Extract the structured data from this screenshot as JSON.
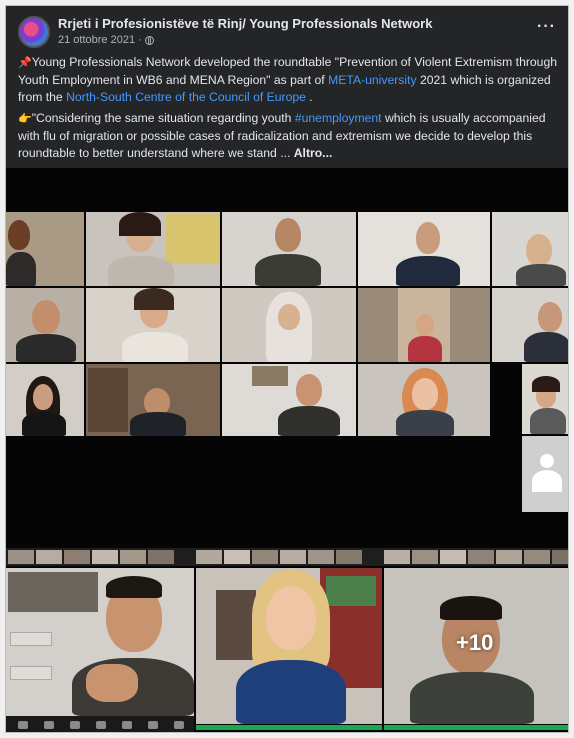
{
  "post": {
    "page_name": "Rrjeti i Profesionistëve të Rinj/ Young Professionals Network",
    "date": "21 ottobre 2021",
    "date_separator": "·",
    "more_options": "···",
    "paragraph1": {
      "prefix": "Young Professionals Network developed the roundtable \"Prevention of Violent Extremism through Youth Employment in WB6 and MENA Region\" as part of ",
      "link1": "META-university",
      "middle": " 2021 which is organized from the ",
      "link2": "North-South Centre of the Council of Europe",
      "suffix": " ."
    },
    "paragraph2": {
      "prefix": "\"Considering the same situation regarding youth ",
      "hashtag": "#unemployment",
      "suffix": " which is usually accompanied with flu of migration or possible cases of radicalization and extremism we decide to develop this roundtable to better understand where we stand ... ",
      "more": "Altro..."
    },
    "photo_more_count": "+10"
  },
  "icons": {
    "pin": "pushpin-icon",
    "hand": "pointing-hand-icon",
    "globe": "globe-icon",
    "more": "more-options-icon"
  },
  "colors": {
    "background": "#242526",
    "text": "#e4e6eb",
    "link": "#4599ff",
    "meta": "#b0b3b8",
    "speaker_bar": "#19a94f"
  }
}
